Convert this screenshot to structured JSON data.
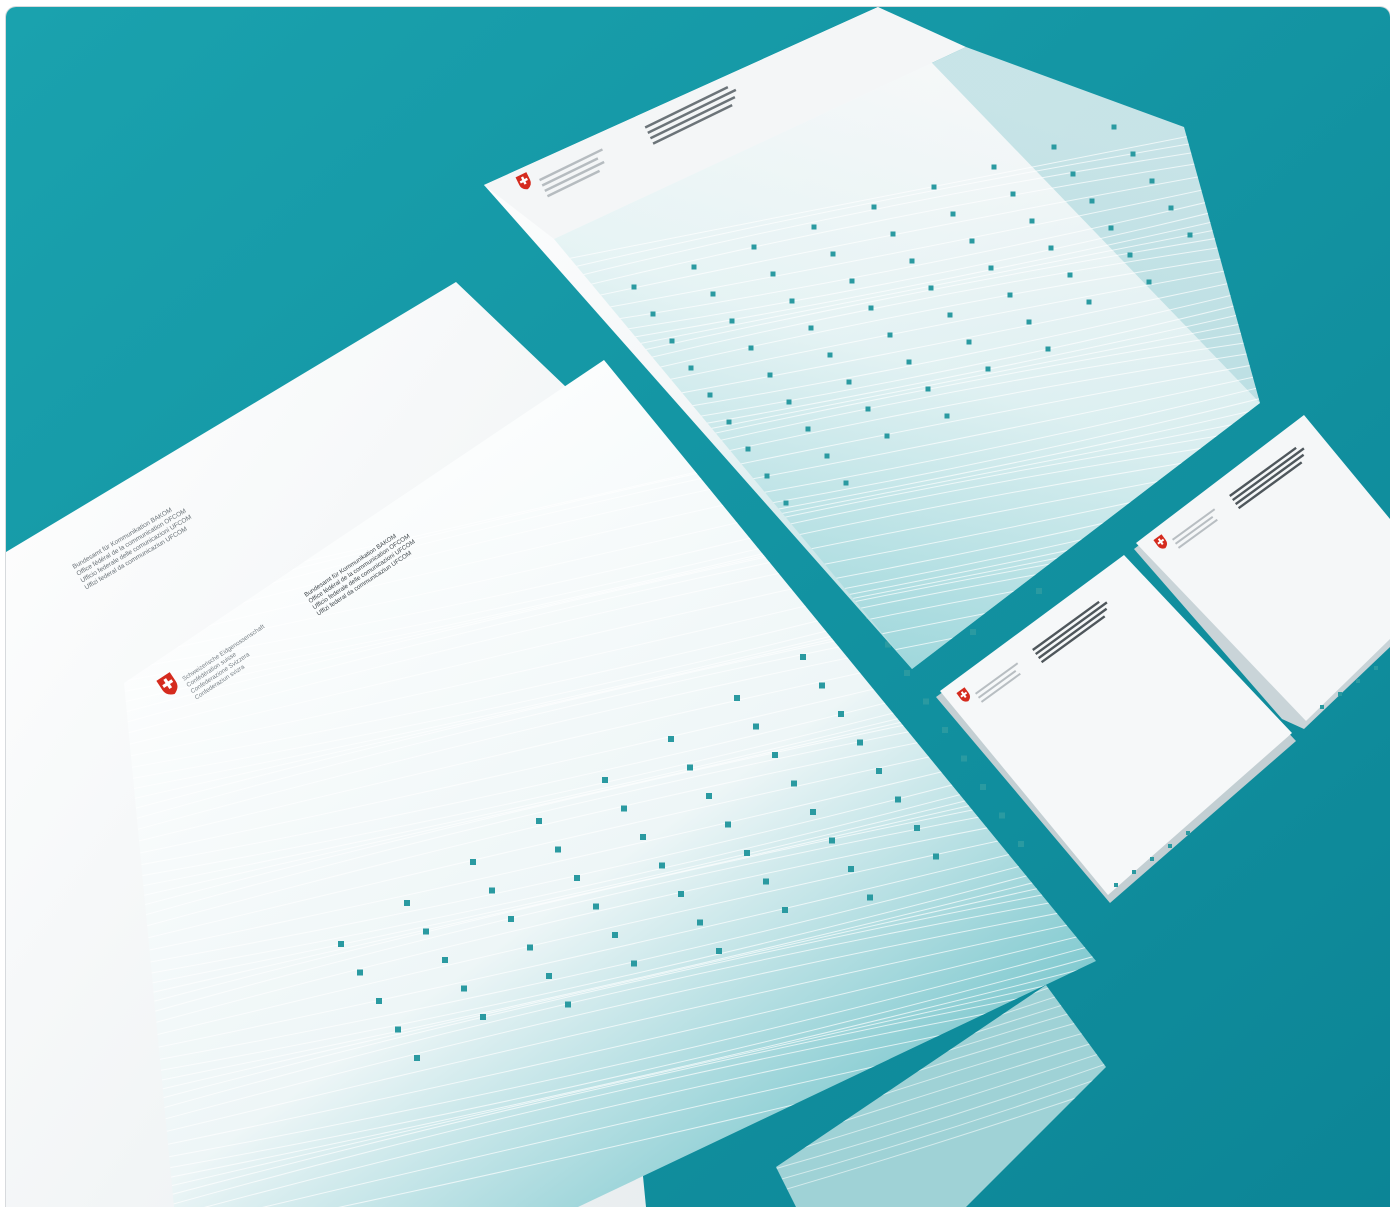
{
  "image": {
    "subject": "Swiss federal stationery set (letterheads, folder, compliments cards) on teal surface",
    "background_color": "#1698a5",
    "paper_color": "#f4f6f7",
    "accent_color": "#2a9aa1",
    "emblem_color": "#d52b1e"
  },
  "letterhead_main": {
    "confederation_lines": [
      "Schweizerische Eidgenossenschaft",
      "Confédération suisse",
      "Confederazione Svizzera",
      "Confederaziun svizra"
    ],
    "office_lines": [
      "Bundesamt für Kommunikation BAKOM",
      "Office fédéral de la communication OFCOM",
      "Ufficio federale delle comunicazioni UFCOM",
      "Uffizi federal da communicaziun UFCOM"
    ]
  },
  "letterhead_back": {
    "office_lines": [
      "Bundesamt für Kommunikation BAKOM",
      "Office fédéral de la communication OFCOM",
      "Ufficio federale delle comunicazioni UFCOM",
      "Uffizi federal da communicaziun UFCOM"
    ]
  }
}
